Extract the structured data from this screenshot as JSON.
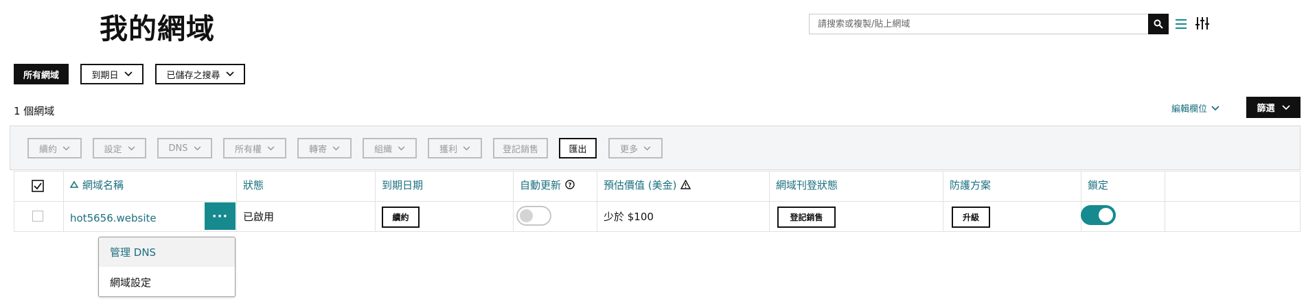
{
  "header": {
    "title": "我的網域",
    "search_placeholder": "請搜索或複製/貼上網域"
  },
  "filters": {
    "all_domains": "所有網域",
    "expiry": "到期日",
    "saved_searches": "已儲存之搜尋"
  },
  "summary": {
    "count_label": "1 個網域",
    "edit_columns": "編輯欄位",
    "filter_button": "篩選"
  },
  "bulk_actions": [
    "續約",
    "設定",
    "DNS",
    "所有權",
    "轉寄",
    "組織",
    "獲利",
    "登記銷售",
    "匯出",
    "更多"
  ],
  "table": {
    "headers": {
      "domain": "網域名稱",
      "status": "狀態",
      "expiry": "到期日期",
      "auto_renew": "自動更新",
      "value": "預估價值 (美金)",
      "listing": "網域刊登狀態",
      "protection": "防護方案",
      "lock": "鎖定"
    },
    "rows": [
      {
        "domain": "hot5656.website",
        "more": "···",
        "status": "已啟用",
        "renew_button": "續約",
        "auto_renew": false,
        "value": "少於 $100",
        "listing_button": "登記銷售",
        "protection_button": "升級",
        "locked": true
      }
    ]
  },
  "context_menu": {
    "items": [
      "管理 DNS",
      "網域設定"
    ]
  },
  "colors": {
    "accent": "#168a8f",
    "link": "#1b6f7f",
    "dark": "#111111"
  }
}
